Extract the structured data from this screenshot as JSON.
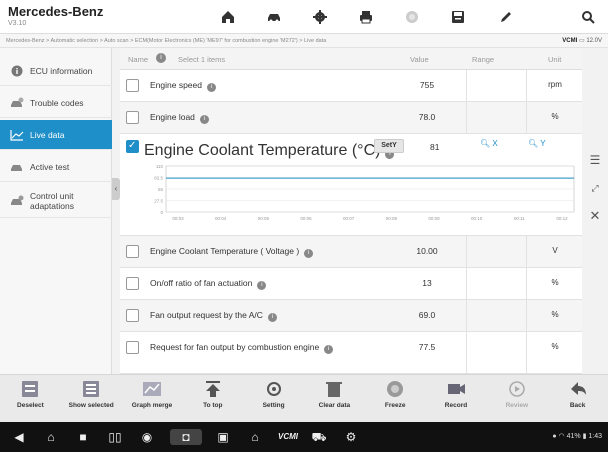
{
  "app": {
    "title": "Mercedes-Benz",
    "version": "V3.10"
  },
  "breadcrumb": "Mercedes-Benz > Automatic selection > Auto scan > ECM(Motor Electronics (ME) 'ME97' for combustion engine 'M272') > Live data",
  "vci": {
    "label": "VCMI",
    "voltage": "12.0V"
  },
  "sidebar": {
    "items": [
      {
        "label": "ECU information",
        "icon": "info-icon"
      },
      {
        "label": "Trouble codes",
        "icon": "car-error-icon"
      },
      {
        "label": "Live data",
        "icon": "graph-icon"
      },
      {
        "label": "Active test",
        "icon": "car-test-icon"
      },
      {
        "label": "Control unit adaptations",
        "icon": "car-settings-icon"
      }
    ],
    "active_index": 2
  },
  "table": {
    "headers": {
      "name": "Name",
      "select": "Select 1 items",
      "value": "Value",
      "range": "Range",
      "unit": "Unit"
    },
    "rows": [
      {
        "name": "Engine speed",
        "value": "755",
        "unit": "rpm",
        "checked": false
      },
      {
        "name": "Engine load",
        "value": "78.0",
        "unit": "%",
        "checked": false
      },
      {
        "name": "Engine Coolant Temperature   (°C)",
        "value": "81",
        "unit": "",
        "checked": true
      },
      {
        "name": "Engine Coolant Temperature ( Voltage )",
        "value": "10.00",
        "unit": "V",
        "checked": false
      },
      {
        "name": "On/off ratio of fan actuation",
        "value": "13",
        "unit": "%",
        "checked": false
      },
      {
        "name": "Fan output request by the A/C",
        "value": "69.0",
        "unit": "%",
        "checked": false
      },
      {
        "name": "Request for fan output by combustion engine",
        "value": "77.5",
        "unit": "%",
        "checked": false
      }
    ]
  },
  "graph": {
    "sety_label": "SetY",
    "zoom_x": "X",
    "zoom_y": "Y",
    "y_ticks": [
      "110",
      "82.5",
      "55",
      "27.5",
      "0"
    ],
    "x_ticks": [
      "00:03",
      "00:04",
      "00:05",
      "00:06",
      "00:07",
      "00:08",
      "00:09",
      "00:10",
      "00:11",
      "00:12"
    ],
    "series_values": [
      81,
      81,
      81,
      81,
      81,
      81,
      81,
      81,
      81,
      81
    ],
    "ylim": [
      0,
      110
    ],
    "line_color": "#1e8fc8"
  },
  "toolbar": [
    {
      "label": "Deselect",
      "icon": "deselect-icon",
      "enabled": true
    },
    {
      "label": "Show selected",
      "icon": "show-selected-icon",
      "enabled": true
    },
    {
      "label": "Graph merge",
      "icon": "graph-merge-icon",
      "enabled": true
    },
    {
      "label": "To top",
      "icon": "to-top-icon",
      "enabled": true
    },
    {
      "label": "Setting",
      "icon": "setting-icon",
      "enabled": true
    },
    {
      "label": "Clear data",
      "icon": "trash-icon",
      "enabled": true
    },
    {
      "label": "Freeze",
      "icon": "freeze-icon",
      "enabled": true
    },
    {
      "label": "Record",
      "icon": "record-icon",
      "enabled": true
    },
    {
      "label": "Review",
      "icon": "review-icon",
      "enabled": false
    },
    {
      "label": "Back",
      "icon": "back-icon",
      "enabled": true
    }
  ],
  "status_bar": {
    "battery": "41%",
    "time": "1:43",
    "vcmi_label": "VCMI"
  },
  "colors": {
    "accent": "#1e8fc8"
  }
}
